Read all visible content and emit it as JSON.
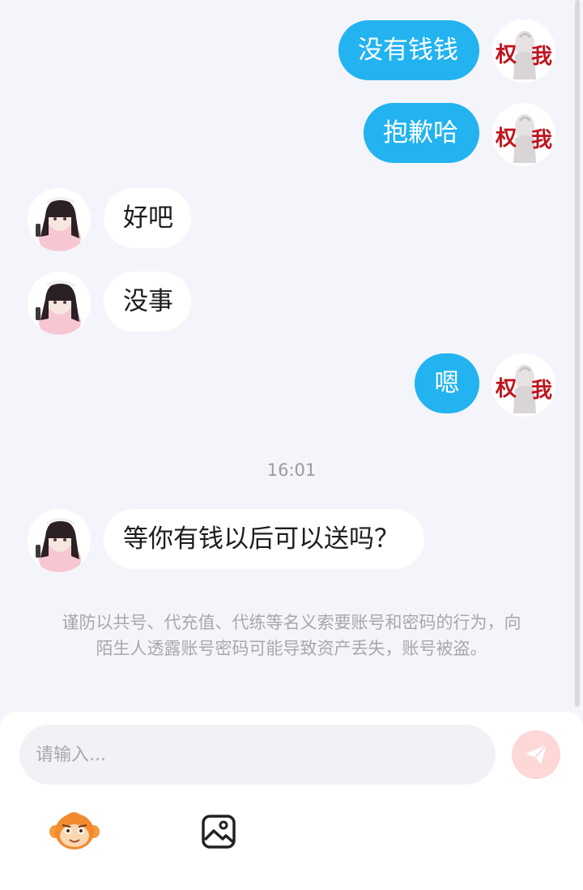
{
  "messages": [
    {
      "side": "self",
      "text": "没有钱钱"
    },
    {
      "side": "self",
      "text": "抱歉哈"
    },
    {
      "side": "other",
      "text": "好吧"
    },
    {
      "side": "other",
      "text": "没事"
    },
    {
      "side": "self",
      "text": "嗯"
    },
    {
      "side": "other",
      "text": "等你有钱以后可以送吗？"
    }
  ],
  "timestamp": "16:01",
  "notice": "谨防以共号、代充值、代练等名义索要账号和密码的行为，向陌生人透露账号密码可能导致资产丢失，账号被盗。",
  "self_avatar": {
    "glyph_left": "权",
    "glyph_right": "我"
  },
  "input": {
    "placeholder": "请输入..."
  },
  "icons": {
    "send": "paper-plane-icon",
    "emoji": "monkey-emoji-icon",
    "image": "image-picker-icon"
  },
  "colors": {
    "self_bubble": "#22b3f0",
    "other_bubble": "#ffffff",
    "background": "#f4f5fa",
    "send_button": "#fdd8d6"
  }
}
